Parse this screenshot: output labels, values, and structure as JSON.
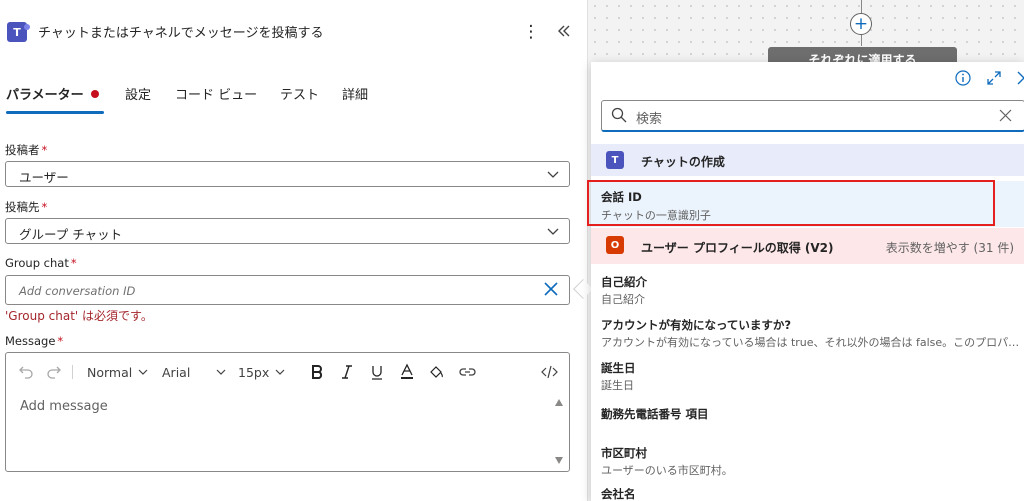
{
  "panel": {
    "title": "チャットまたはチャネルでメッセージを投稿する",
    "tabs": [
      {
        "label": "パラメーター",
        "active": true
      },
      {
        "label": "設定"
      },
      {
        "label": "コード ビュー"
      },
      {
        "label": "テスト"
      },
      {
        "label": "詳細"
      }
    ]
  },
  "form": {
    "post_as": {
      "label": "投稿者",
      "value": "ユーザー"
    },
    "post_in": {
      "label": "投稿先",
      "value": "グループ チャット"
    },
    "group_chat": {
      "label": "Group chat",
      "placeholder": "Add conversation ID",
      "error": "'Group chat' は必須です。"
    },
    "message": {
      "label": "Message",
      "placeholder": "Add message",
      "toolbar": {
        "paragraph": "Normal",
        "font": "Arial",
        "size": "15px"
      }
    },
    "required_mark": "*"
  },
  "canvas": {
    "apply_label": "それぞれに適用する"
  },
  "dynamic_content": {
    "search_placeholder": "検索",
    "sections": [
      {
        "name": "チャットの作成",
        "icon": "teams-icon",
        "items": [
          {
            "title": "会話 ID",
            "desc": "チャットの一意識別子"
          }
        ]
      },
      {
        "name": "ユーザー プロフィールの取得 (V2)",
        "icon": "office-icon",
        "more": "表示数を増やす (31 件)",
        "items": [
          {
            "title": "自己紹介",
            "desc": "自己紹介"
          },
          {
            "title": "アカウントが有効になっていますか?",
            "desc": "アカウントが有効になっている場合は true、それ以外の場合は false。このプロパ…"
          },
          {
            "title": "誕生日",
            "desc": "誕生日"
          },
          {
            "title": "勤務先電話番号 項目",
            "desc": ""
          },
          {
            "title": "市区町村",
            "desc": "ユーザーのいる市区町村。"
          },
          {
            "title": "会社名",
            "desc": ""
          }
        ]
      }
    ]
  },
  "colors": {
    "accent": "#0f6cbd",
    "error": "#c50f1f",
    "teams": "#4b53bc",
    "office": "#d83b01",
    "highlight_box": "#e51e1e"
  }
}
